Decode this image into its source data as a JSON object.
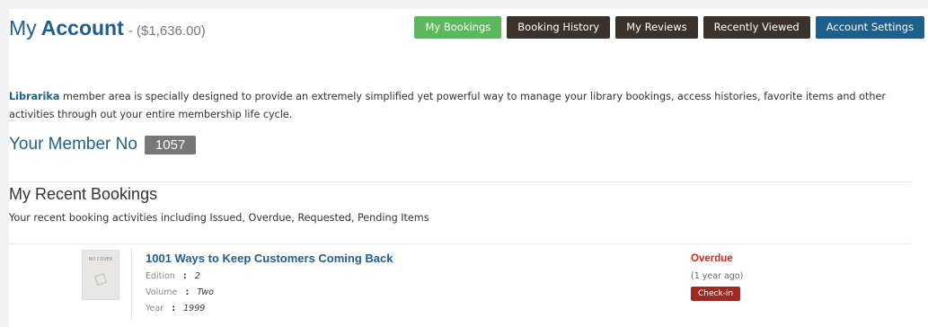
{
  "header": {
    "title_my": "My",
    "title_account": "Account",
    "balance": "- ($1,636.00)"
  },
  "nav": [
    {
      "label": "My Bookings"
    },
    {
      "label": "Booking History"
    },
    {
      "label": "My Reviews"
    },
    {
      "label": "Recently Viewed"
    },
    {
      "label": "Account Settings"
    }
  ],
  "intro": {
    "brand": "Librarika",
    "text": " member area is specially designed to provide an extremely simplified yet powerful way to manage your library bookings, access histories, favorite items and other activities through out your entire membership life cycle."
  },
  "member": {
    "label": "Your Member No",
    "number": "1057"
  },
  "bookings": {
    "title": "My Recent Bookings",
    "subtitle": "Your recent booking activities including Issued, Overdue, Requested, Pending Items",
    "items": [
      {
        "cover_text": "NO COVER",
        "title": "1001 Ways to Keep Customers Coming Back",
        "edition_label": "Edition",
        "edition": "2",
        "volume_label": "Volume",
        "volume": "Two",
        "year_label": "Year",
        "year": "1999",
        "separator": ":",
        "status": "Overdue",
        "ago": "(1 year ago)",
        "action": "Check-in"
      }
    ]
  },
  "colors": {
    "primary": "#1f5f8b",
    "success": "#5cb85c",
    "dark": "#3a322b",
    "danger": "#d9231c"
  }
}
